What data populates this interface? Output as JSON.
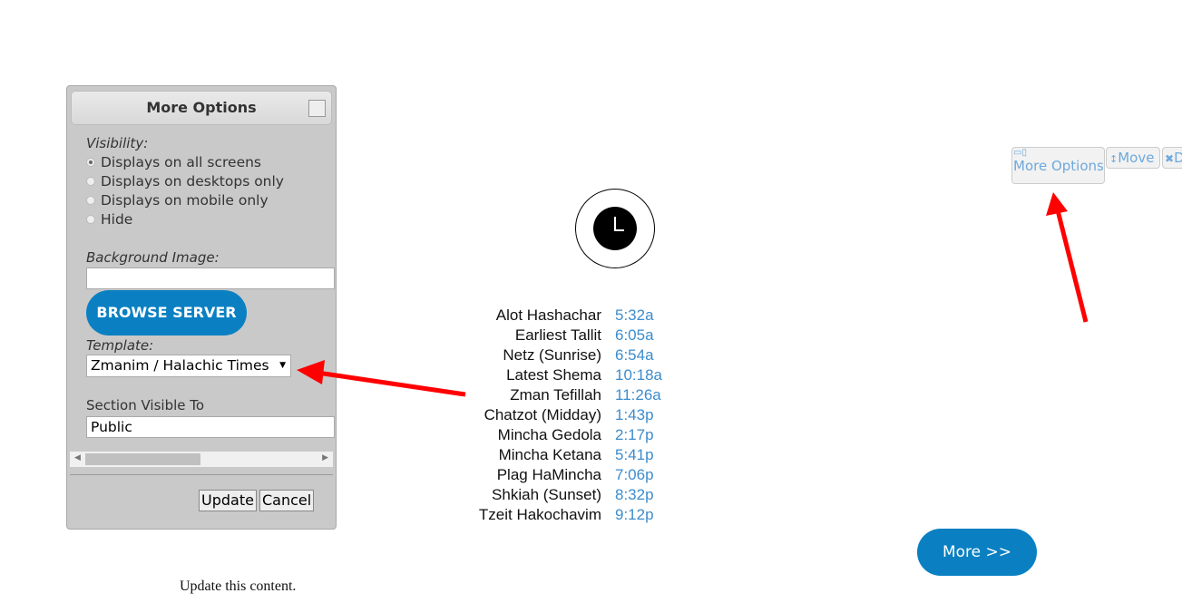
{
  "dialog": {
    "title": "More Options",
    "visibility_label": "Visibility:",
    "visibility_options": [
      "Displays on all screens",
      "Displays on desktops only",
      "Displays on mobile only",
      "Hide"
    ],
    "visibility_selected": 0,
    "background_label": "Background Image:",
    "background_value": "",
    "browse_label": "BROWSE SERVER",
    "template_label": "Template:",
    "template_value": "Zmanim / Halachic Times",
    "section_label": "Section Visible To",
    "section_value": "Public",
    "update_label": "Update",
    "cancel_label": "Cancel"
  },
  "zmanim": [
    {
      "name": "Alot Hashachar",
      "time": "5:32a"
    },
    {
      "name": "Earliest Tallit",
      "time": "6:05a"
    },
    {
      "name": "Netz (Sunrise)",
      "time": "6:54a"
    },
    {
      "name": "Latest Shema",
      "time": "10:18a"
    },
    {
      "name": "Zman Tefillah",
      "time": "11:26a"
    },
    {
      "name": "Chatzot (Midday)",
      "time": "1:43p"
    },
    {
      "name": "Mincha Gedola",
      "time": "2:17p"
    },
    {
      "name": "Mincha Ketana",
      "time": "5:41p"
    },
    {
      "name": "Plag HaMincha",
      "time": "7:06p"
    },
    {
      "name": "Shkiah (Sunset)",
      "time": "8:32p"
    },
    {
      "name": "Tzeit Hakochavim",
      "time": "9:12p"
    }
  ],
  "more_button": "More >>",
  "toolbar": {
    "more_options": "More Options",
    "move": "Move",
    "delete": "D"
  },
  "footer": "Update this content.",
  "colors": {
    "accent": "#0a80c2",
    "time": "#3d8ccc",
    "arrow": "#ff0000"
  }
}
